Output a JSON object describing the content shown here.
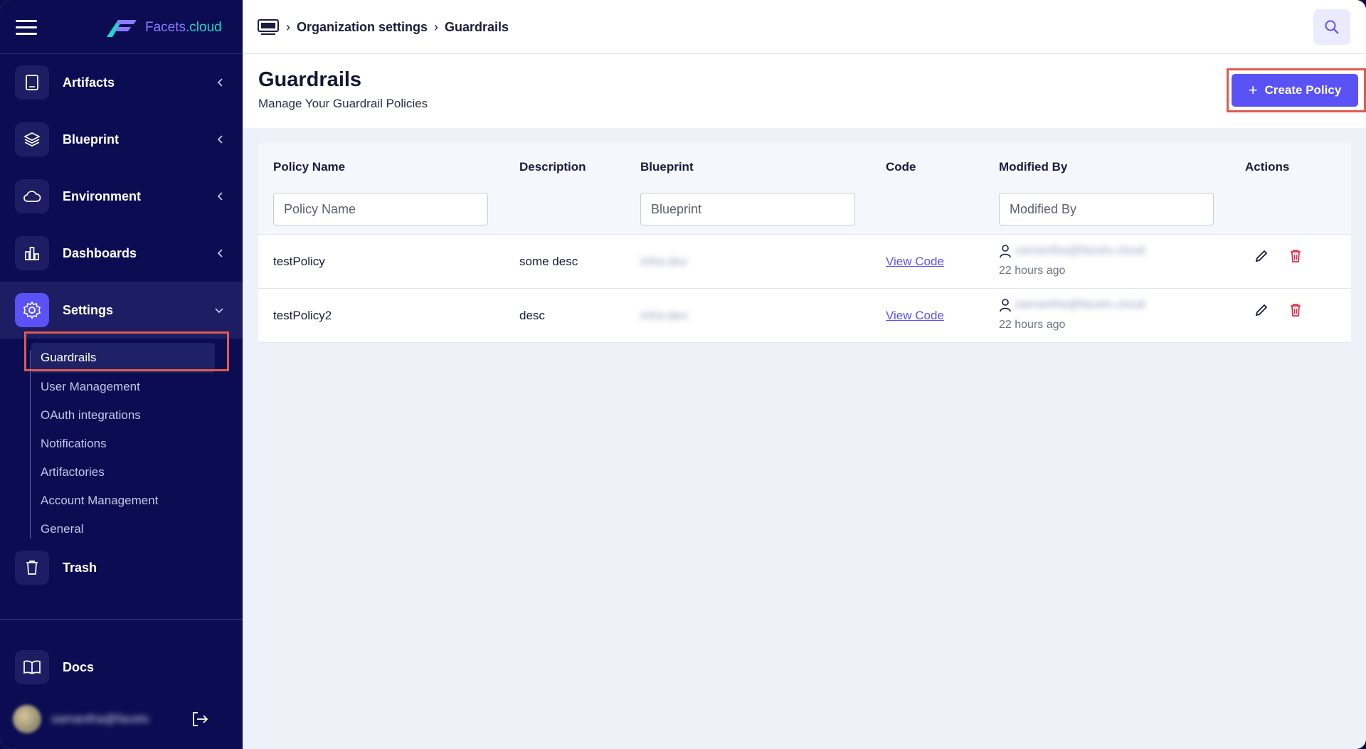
{
  "app": {
    "logo_main": "Facets",
    "logo_suffix": ".cloud"
  },
  "sidebar": {
    "items": [
      {
        "label": "Artifacts"
      },
      {
        "label": "Blueprint"
      },
      {
        "label": "Environment"
      },
      {
        "label": "Dashboards"
      },
      {
        "label": "Settings"
      }
    ],
    "settings_sub": [
      {
        "label": "Guardrails"
      },
      {
        "label": "User Management"
      },
      {
        "label": "OAuth integrations"
      },
      {
        "label": "Notifications"
      },
      {
        "label": "Artifactories"
      },
      {
        "label": "Account Management"
      },
      {
        "label": "General"
      }
    ],
    "trash_label": "Trash",
    "docs_label": "Docs",
    "username": "samantha@facets"
  },
  "breadcrumb": {
    "root": "Organization settings",
    "current": "Guardrails"
  },
  "page": {
    "title": "Guardrails",
    "subtitle": "Manage Your Guardrail Policies",
    "create_label": "Create Policy"
  },
  "table": {
    "headers": {
      "policy_name": "Policy Name",
      "description": "Description",
      "blueprint": "Blueprint",
      "code": "Code",
      "modified_by": "Modified By",
      "actions": "Actions"
    },
    "filters": {
      "policy_name": "Policy Name",
      "blueprint": "Blueprint",
      "modified_by": "Modified By"
    },
    "rows": [
      {
        "name": "testPolicy",
        "description": "some desc",
        "blueprint": "infra-dev",
        "code": "View Code",
        "user": "samantha@facets.cloud",
        "time": "22 hours ago"
      },
      {
        "name": "testPolicy2",
        "description": "desc",
        "blueprint": "infra-dev",
        "code": "View Code",
        "user": "samantha@facets.cloud",
        "time": "22 hours ago"
      }
    ]
  }
}
